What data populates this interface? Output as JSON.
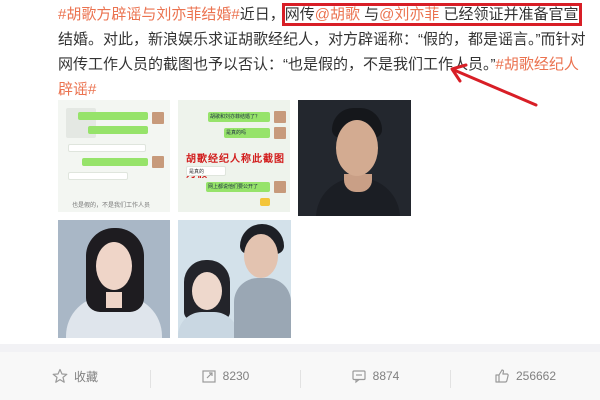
{
  "post": {
    "hashtag1": "#胡歌方辟谣与刘亦菲结婚#",
    "text_a": "近日，",
    "hl_prefix": "网传",
    "mention1": "@胡歌",
    "hl_mid": " 与",
    "mention2": "@刘亦菲",
    "hl_suffix": " 已经领证并准备官宣",
    "text_b": "结婚。对此，新浪娱乐求证胡歌经纪人，对方辟谣称：“假的，都是谣言。”而针对网传工作人员的截图也予以否认：“也是假的，不是我们工作人员。”",
    "hashtag2": "#胡歌经纪人辟谣#"
  },
  "images": {
    "chat2_stamp": "胡歌经纪人称此截图为假",
    "chat2_bubble1": "胡歌和刘亦菲结婚了？",
    "chat2_bubble2": "是真的吗",
    "chat2_bubble3": "是真的",
    "chat2_bubble4": "网上都说他们要公开了",
    "chat1_caption": "也是假的，不是我们工作人员"
  },
  "toolbar": {
    "collect": "收藏",
    "repost": "8230",
    "comment": "8874",
    "like": "256662"
  },
  "colors": {
    "link": "#eb7350",
    "highlight_box": "#d81e26",
    "arrow": "#d81e26",
    "toolbar_bg": "#f8f8f8"
  }
}
